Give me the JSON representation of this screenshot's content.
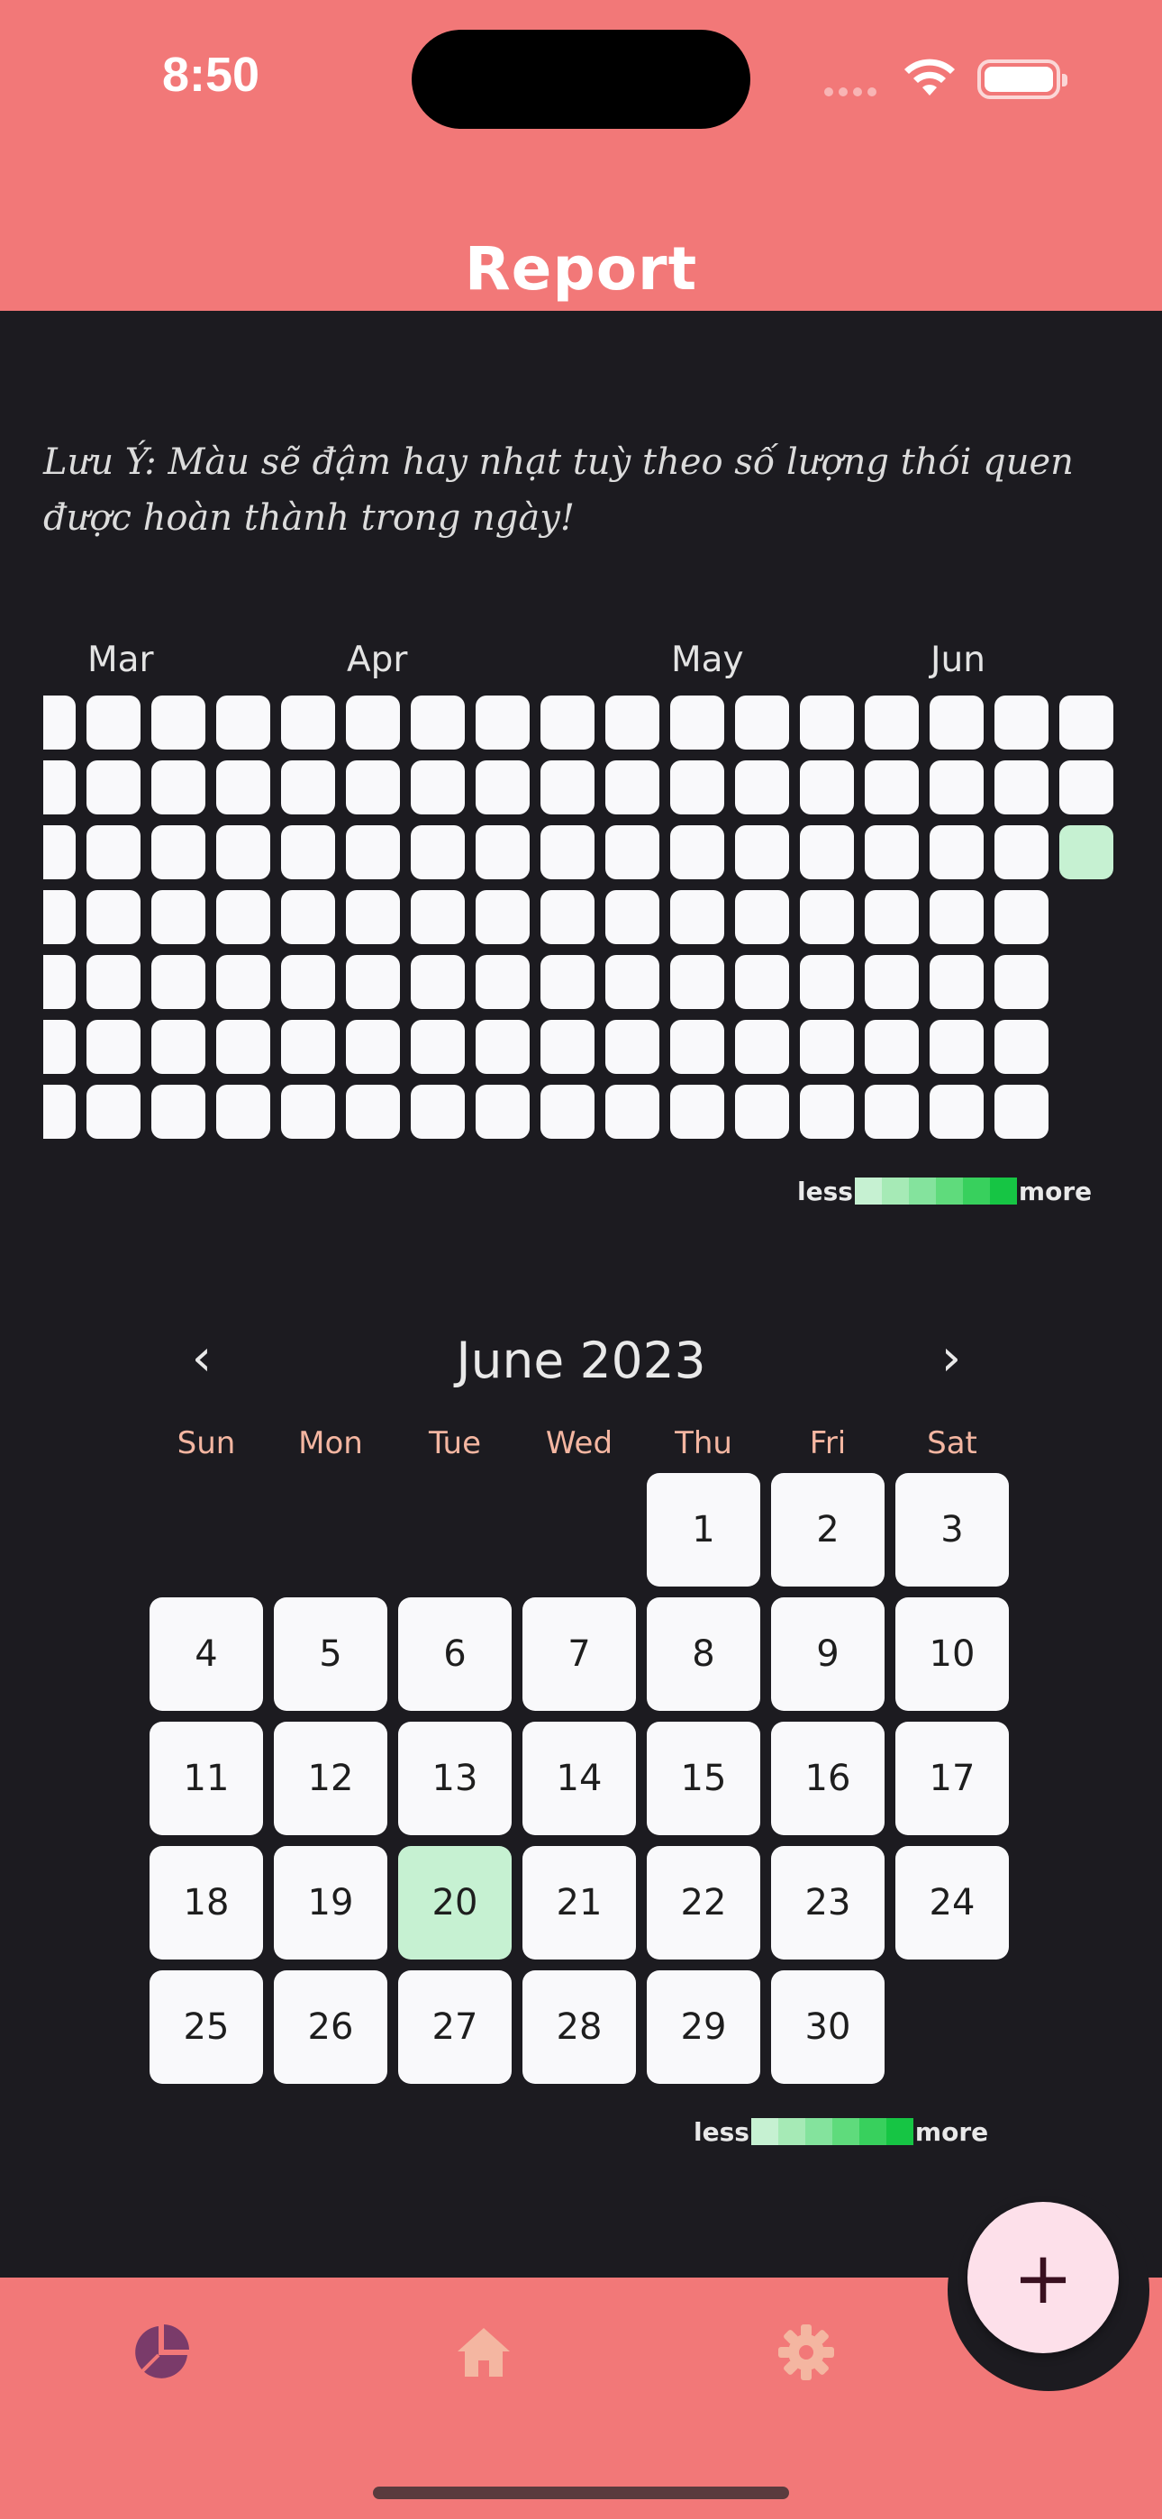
{
  "status": {
    "time": "8:50"
  },
  "header": {
    "title": "Report"
  },
  "note": "Lưu Ý: Màu sẽ đậm hay nhạt tuỳ theo số lượng thói quen được hoàn thành trong ngày!",
  "heatmap": {
    "months": [
      "Mar",
      "Apr",
      "May",
      "Jun"
    ],
    "highlighted_cell": "2023-06-20",
    "legend": {
      "less": "less",
      "more": "more"
    },
    "levels": [
      "#c6f1d2",
      "#a6eab6",
      "#84e39d",
      "#5fdb7c",
      "#38d05d",
      "#16c544"
    ]
  },
  "calendar": {
    "title": "June 2023",
    "prev_icon": "chevron-left-icon",
    "next_icon": "chevron-right-icon",
    "weekdays": [
      "Sun",
      "Mon",
      "Tue",
      "Wed",
      "Thu",
      "Fri",
      "Sat"
    ],
    "days": [
      "1",
      "2",
      "3",
      "4",
      "5",
      "6",
      "7",
      "8",
      "9",
      "10",
      "11",
      "12",
      "13",
      "14",
      "15",
      "16",
      "17",
      "18",
      "19",
      "20",
      "21",
      "22",
      "23",
      "24",
      "25",
      "26",
      "27",
      "28",
      "29",
      "30"
    ],
    "first_weekday_index": 4,
    "highlighted_day": "20",
    "legend": {
      "less": "less",
      "more": "more"
    }
  },
  "bottom_nav": {
    "items": [
      "chart-pie-icon",
      "home-icon",
      "gear-icon"
    ],
    "fab_label": "+"
  },
  "colors": {
    "accent": "#f27878",
    "background": "#1c1b20",
    "cell": "#f9f9fb",
    "active_icon": "#7a3b6a",
    "inactive_icon": "#f4b6a1",
    "fab": "#fde0ea"
  }
}
